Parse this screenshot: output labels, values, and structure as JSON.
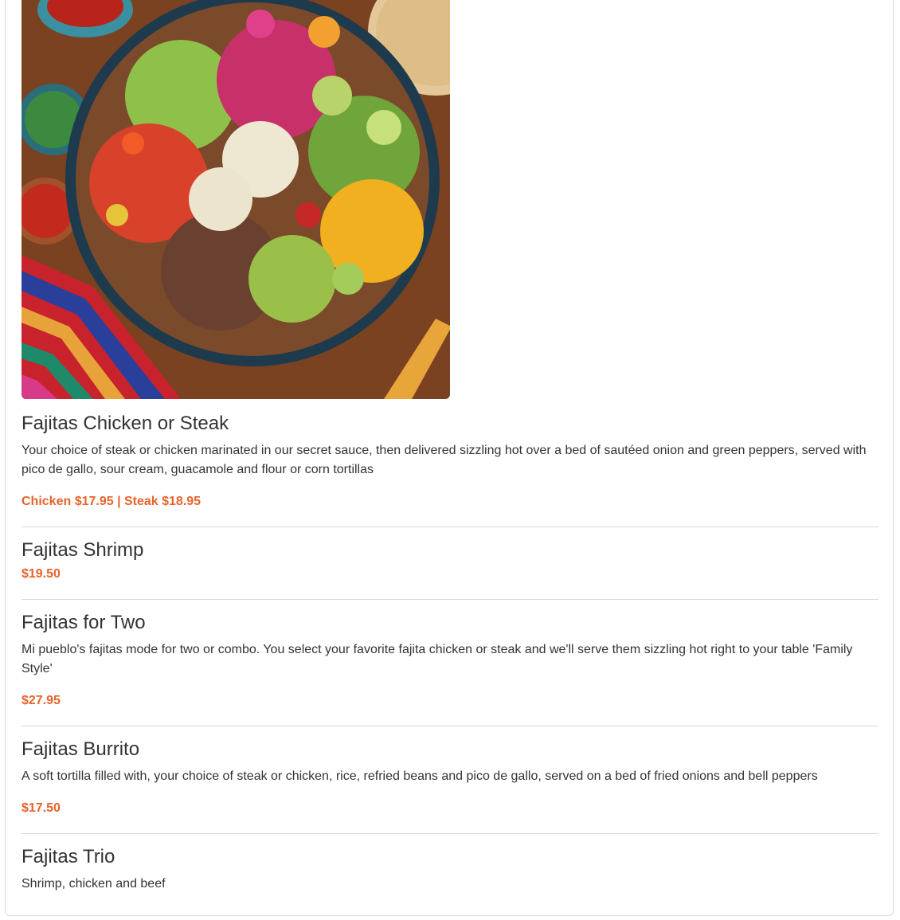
{
  "colors": {
    "price": "#e8632b",
    "text": "#333333",
    "divider": "#d9d9d9"
  },
  "photo": {
    "alt": "fajita-bowl-photo"
  },
  "items": [
    {
      "name": "Fajitas Chicken or Steak",
      "description": "Your choice of steak or chicken marinated in our secret sauce, then delivered sizzling hot over a bed of sautéed onion and green peppers, served with pico de gallo, sour cream, guacamole and flour or corn tortillas",
      "price": "Chicken $17.95 | Steak $18.95"
    },
    {
      "name": "Fajitas Shrimp",
      "description": "",
      "price": "$19.50"
    },
    {
      "name": "Fajitas for Two",
      "description": "Mi pueblo's fajitas mode for two or combo. You select your favorite fajita chicken or steak and we'll serve them sizzling hot right to your table 'Family Style'",
      "price": "$27.95"
    },
    {
      "name": "Fajitas Burrito",
      "description": "A soft tortilla filled with, your choice of steak or chicken, rice, refried beans and pico de gallo, served on a bed of fried onions and bell peppers",
      "price": "$17.50"
    },
    {
      "name": "Fajitas Trio",
      "description": "Shrimp, chicken and beef",
      "price": ""
    }
  ]
}
